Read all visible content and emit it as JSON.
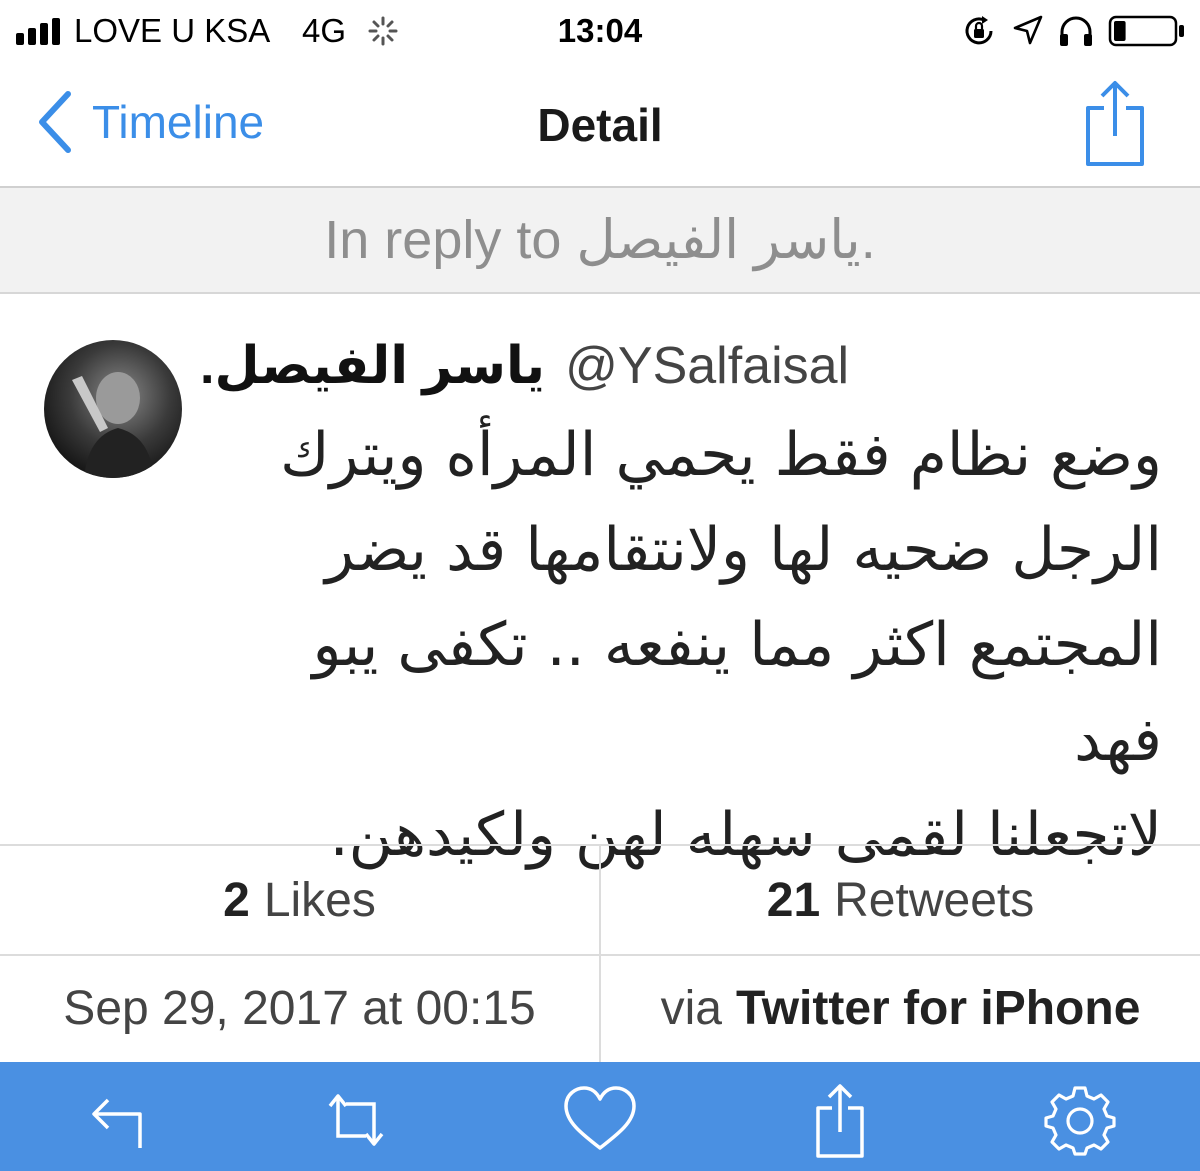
{
  "status_bar": {
    "carrier": "LOVE U KSA",
    "network": "4G",
    "time": "13:04",
    "icons": [
      "signal-icon",
      "loading-spinner-icon",
      "rotation-lock-icon",
      "location-arrow-icon",
      "headphones-icon",
      "battery-icon"
    ],
    "battery_level": 0.2
  },
  "nav": {
    "back_label": "Timeline",
    "title": "Detail",
    "accent_color": "#3b8ee8"
  },
  "reply_banner": {
    "text": "In reply to ياسر الفيصل."
  },
  "tweet": {
    "display_name": "ياسر الفيصل.",
    "handle": "@YSalfaisal",
    "lines": [
      "وضع نظام فقط يحمي المرأه ويترك",
      "الرجل ضحيه لها ولانتقامها قد يضر",
      "المجتمع اكثر مما ينفعه .. تكفى يبو فهد",
      "لاتجعلنا لقمى سهله لهن ولكيدهن."
    ]
  },
  "stats": {
    "likes_count": "2",
    "likes_label": "Likes",
    "retweets_count": "21",
    "retweets_label": "Retweets"
  },
  "meta": {
    "timestamp": "Sep 29, 2017 at 00:15",
    "via_prefix": "via",
    "source": "Twitter for iPhone"
  },
  "toolbar": {
    "background": "#4a90e2",
    "icons": [
      "reply-icon",
      "retweet-icon",
      "heart-icon",
      "share-icon",
      "settings-gear-icon"
    ]
  }
}
